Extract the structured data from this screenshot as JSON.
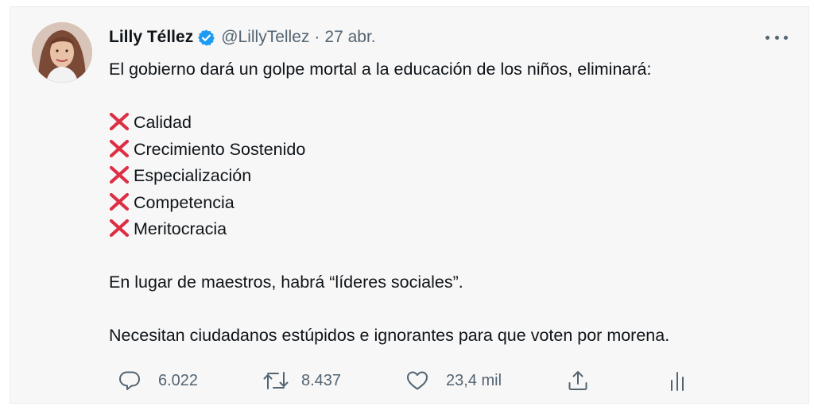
{
  "tweet": {
    "author_name": "Lilly Téllez",
    "handle": "@LillyTellez",
    "separator": "·",
    "date": "27 abr.",
    "intro": "El gobierno dará un golpe mortal a la educación de los niños, eliminará:",
    "items": [
      "Calidad",
      "Crecimiento Sostenido",
      "Especialización",
      "Competencia",
      "Meritocracia"
    ],
    "paragraph_2": "En lugar de maestros, habrá “líderes sociales”.",
    "paragraph_3": "Necesitan ciudadanos estúpidos e ignorantes para que voten por morena.",
    "replies": "6.022",
    "retweets": "8.437",
    "likes": "23,4 mil"
  },
  "colors": {
    "card_background": "#f7f7f7",
    "verified_badge": "#1d9bf0",
    "cross_mark": "#dd2e44",
    "secondary_text": "#536471",
    "primary_text": "#0f1419"
  },
  "icons": {
    "verified": "verified-badge-icon",
    "more": "more-options-icon",
    "cross": "cross-mark-emoji-icon",
    "reply": "reply-bubble-icon",
    "retweet": "retweet-icon",
    "like": "heart-icon",
    "share": "share-icon",
    "analytics": "analytics-bars-icon"
  }
}
